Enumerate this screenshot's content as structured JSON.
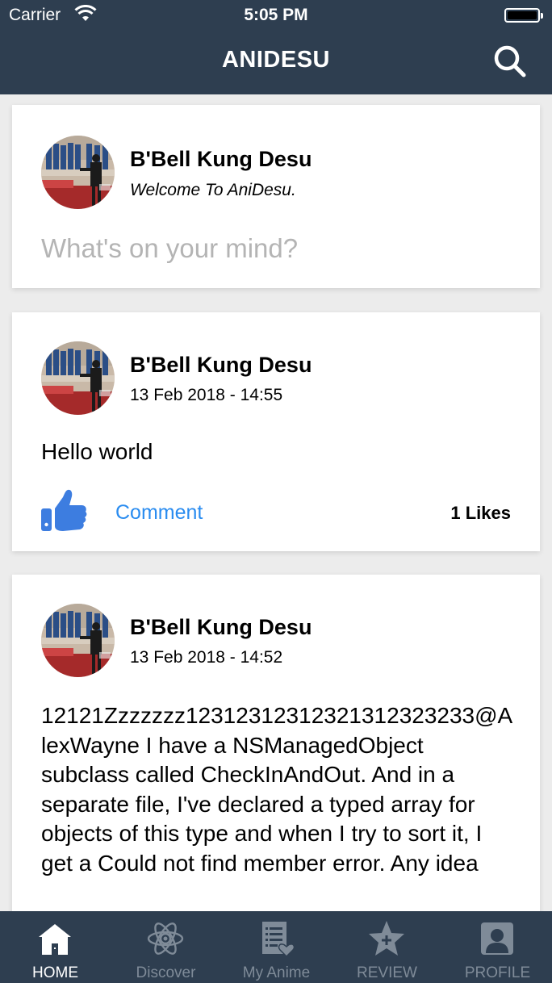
{
  "status_bar": {
    "carrier": "Carrier",
    "time": "5:05 PM"
  },
  "nav": {
    "title": "ANIDESU",
    "search_icon": "search-icon"
  },
  "composer": {
    "name": "B'Bell Kung Desu",
    "tagline": "Welcome To AniDesu.",
    "placeholder": "What's on your mind?"
  },
  "posts": [
    {
      "name": "B'Bell Kung Desu",
      "date": "13 Feb 2018 - 14:55",
      "text": "Hello world",
      "comment_label": "Comment",
      "likes": "1 Likes"
    },
    {
      "name": "B'Bell Kung Desu",
      "date": "13 Feb 2018 - 14:52",
      "text": "12121Zzzzzzz12312312312321312323233@AlexWayne I have a NSManagedObject subclass called CheckInAndOut. And in a separate file, I've declared a typed array for objects of this type and when I try to sort it, I get a Could not find member error. Any idea"
    }
  ],
  "tabs": [
    {
      "label": "HOME",
      "icon": "home-icon",
      "active": true
    },
    {
      "label": "Discover",
      "icon": "atom-icon",
      "active": false
    },
    {
      "label": "My Anime",
      "icon": "list-heart-icon",
      "active": false
    },
    {
      "label": "REVIEW",
      "icon": "star-plus-icon",
      "active": false
    },
    {
      "label": "PROFILE",
      "icon": "profile-icon",
      "active": false
    }
  ],
  "colors": {
    "bar": "#2e3e50",
    "accent": "#2a8cf0",
    "like": "#3d7de0",
    "placeholder": "#b4b4b4"
  }
}
